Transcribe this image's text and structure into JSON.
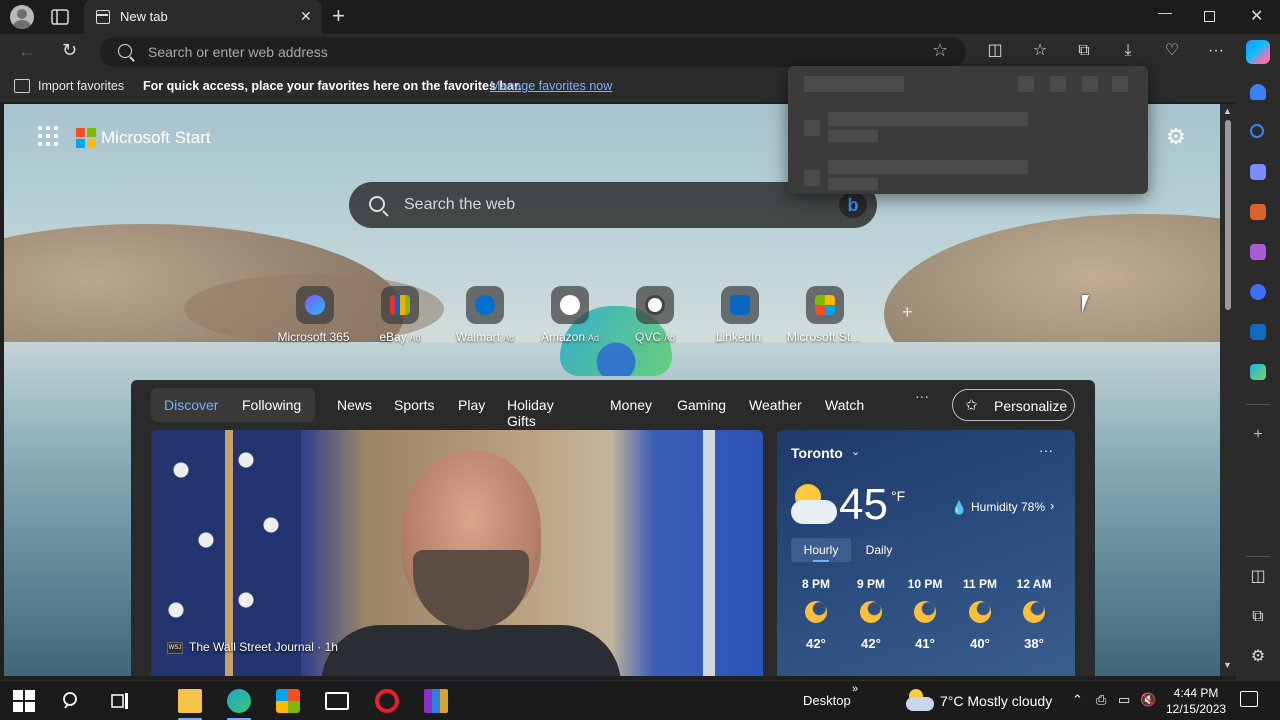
{
  "browser": {
    "tab_title": "New tab",
    "address_placeholder": "Search or enter web address",
    "favorites_import": "Import favorites",
    "favorites_message": "For quick access, place your favorites here on the favorites bar.",
    "favorites_link": "Manage favorites now"
  },
  "page": {
    "brand": "Microsoft Start",
    "search_placeholder": "Search the web",
    "tiles": [
      {
        "label": "Microsoft 365",
        "ad": "",
        "icon": "microsoft365-icon"
      },
      {
        "label": "eBay",
        "ad": "Ad",
        "icon": "ebay-icon"
      },
      {
        "label": "Walmart",
        "ad": "Ad",
        "icon": "walmart-icon"
      },
      {
        "label": "Amazon",
        "ad": "Ad",
        "icon": "amazon-icon"
      },
      {
        "label": "QVC",
        "ad": "Ad",
        "icon": "qvc-icon"
      },
      {
        "label": "LinkedIn",
        "ad": "",
        "icon": "linkedin-icon"
      },
      {
        "label": "Microsoft St...",
        "ad": "",
        "icon": "microsoft-store-icon"
      }
    ],
    "nav": [
      "Discover",
      "Following",
      "News",
      "Sports",
      "Play",
      "Holiday Gifts",
      "Money",
      "Gaming",
      "Weather",
      "Watch"
    ],
    "nav_more": "···",
    "personalize": "Personalize",
    "news_source": "The Wall Street Journal · 1h",
    "news_source_icon": "WSJ"
  },
  "weather": {
    "city": "Toronto",
    "temp": "45",
    "unit": "°F",
    "humidity": "Humidity 78%",
    "tab_hourly": "Hourly",
    "tab_daily": "Daily",
    "more": "···",
    "hours": [
      {
        "time": "8 PM",
        "temp": "42°"
      },
      {
        "time": "9 PM",
        "temp": "42°"
      },
      {
        "time": "10 PM",
        "temp": "41°"
      },
      {
        "time": "11 PM",
        "temp": "40°"
      },
      {
        "time": "12 AM",
        "temp": "38°"
      }
    ]
  },
  "taskbar": {
    "desktop_label": "Desktop",
    "weather": "7°C  Mostly cloudy",
    "time": "4:44 PM",
    "date": "12/15/2023"
  },
  "colors": {
    "accent": "#6fb2ff",
    "link": "#7ab3ff"
  }
}
